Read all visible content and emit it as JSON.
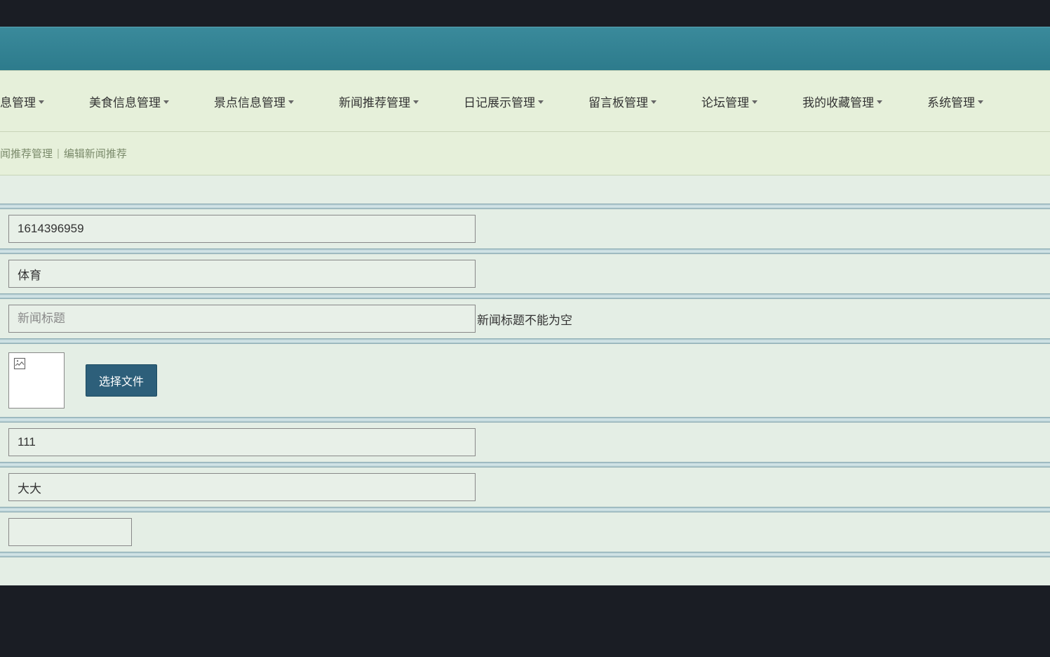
{
  "nav": {
    "items": [
      {
        "label": "息管理"
      },
      {
        "label": "美食信息管理"
      },
      {
        "label": "景点信息管理"
      },
      {
        "label": "新闻推荐管理"
      },
      {
        "label": "日记展示管理"
      },
      {
        "label": "留言板管理"
      },
      {
        "label": "论坛管理"
      },
      {
        "label": "我的收藏管理"
      },
      {
        "label": "系统管理"
      }
    ]
  },
  "breadcrumb": {
    "part1": "闻推荐管理",
    "part2": "编辑新闻推荐"
  },
  "form": {
    "id_value": "1614396959",
    "category_value": "体育",
    "title_placeholder": "新闻标题",
    "title_validation": "新闻标题不能为空",
    "file_button": "选择文件",
    "field5_value": "111",
    "field6_value": "大大",
    "field7_value": ""
  }
}
